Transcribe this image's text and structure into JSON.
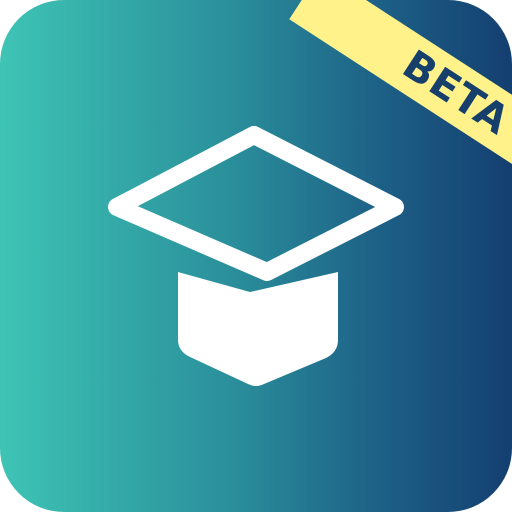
{
  "app_icon": {
    "badge_label": "BETA",
    "icon_name": "graduation-cap-icon",
    "colors": {
      "gradient_start": "#3ec4b5",
      "gradient_end": "#143f70",
      "ribbon": "#fff28a",
      "ribbon_text": "#173f6b",
      "glyph": "#ffffff"
    }
  }
}
